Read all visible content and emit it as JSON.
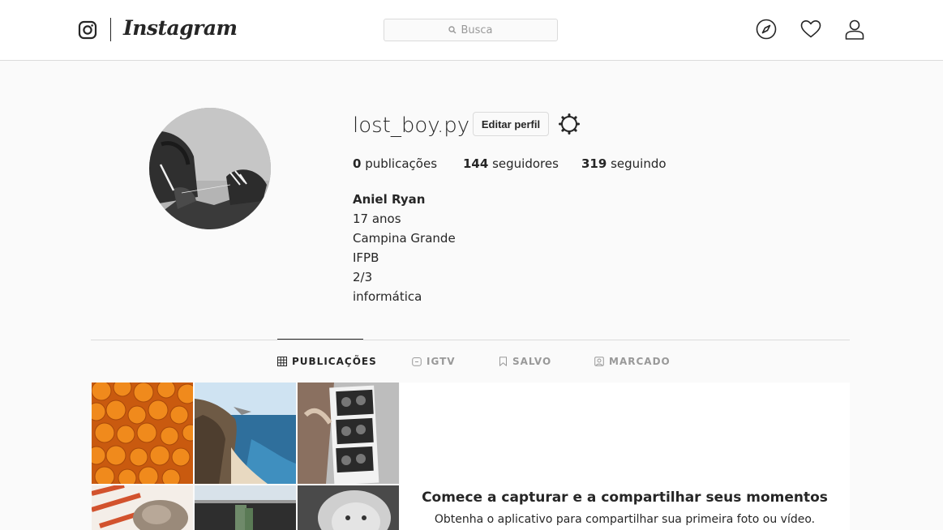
{
  "header": {
    "wordmark": "Instagram",
    "search_placeholder": "Busca",
    "icons": [
      "instagram-logo-icon",
      "compass-icon",
      "heart-icon",
      "user-icon"
    ]
  },
  "profile": {
    "username": "lost_boy.py",
    "edit_label": "Editar perfil",
    "stats": {
      "posts_count": "0",
      "posts_label": "publicações",
      "followers_count": "144",
      "followers_label": "seguidores",
      "following_count": "319",
      "following_label": "seguindo"
    },
    "bio": {
      "name": "Aniel Ryan",
      "lines": [
        "17 anos",
        "Campina Grande",
        "IFPB",
        "2/3",
        "informática"
      ]
    }
  },
  "tabs": [
    {
      "label": "PUBLICAÇÕES",
      "icon": "grid-icon",
      "active": true
    },
    {
      "label": "IGTV",
      "icon": "tv-icon",
      "active": false
    },
    {
      "label": "SALVO",
      "icon": "bookmark-icon",
      "active": false
    },
    {
      "label": "MARCADO",
      "icon": "tag-icon",
      "active": false
    }
  ],
  "promo": {
    "title": "Comece a capturar e a compartilhar seus momentos",
    "subtitle": "Obtenha o aplicativo para compartilhar sua primeira foto ou vídeo."
  },
  "colors": {
    "background": "#fafafa",
    "border": "#dbdbdb",
    "text": "#262626",
    "muted": "#999999"
  }
}
